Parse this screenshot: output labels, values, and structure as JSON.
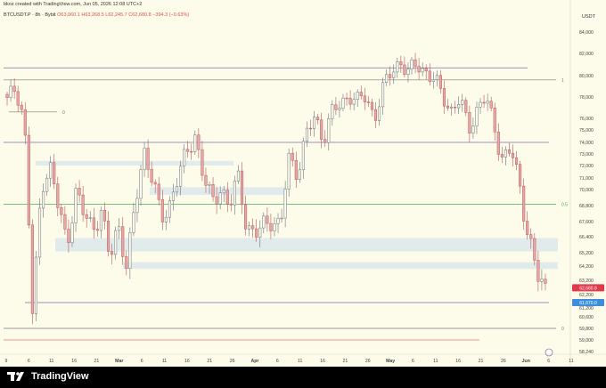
{
  "header": {
    "attribution": "bkoz created with TradingView.com, Jun 05, 2026 12:08 UTC+2"
  },
  "ohlc": {
    "symbol": "BTCUSDT.P · 8h · Bybit",
    "open": "O63,060.1",
    "high": "H63,268.5",
    "low": "L62,245.7",
    "close": "C62,680.8",
    "change": "−394.3 (−0.63%)"
  },
  "brand": {
    "name": "TradingView"
  },
  "colors": {
    "background": "#fdfbea",
    "up_candle": "#26a69a",
    "down_candle": "#ef5350",
    "candle_body": "#e8a8a8",
    "fib_line": "#7a7a7a",
    "green_line": "#4caf50",
    "purple_line": "#7b6fb0",
    "zone": "#dfe9ec",
    "last_price_badge": "#e0394a",
    "mark_price_badge": "#3b8edb"
  },
  "chart_data": {
    "type": "candlestick",
    "currency": "USDT",
    "ylim": [
      58000,
      85000
    ],
    "y_ticks": [
      "84,000",
      "82,000",
      "80,000",
      "78,000",
      "76,000",
      "75,000",
      "74,000",
      "73,000",
      "72,000",
      "71,000",
      "70,000",
      "68,800",
      "67,600",
      "66,400",
      "65,200",
      "64,200",
      "63,200",
      "62,200",
      "61,200",
      "60,600",
      "59,800",
      "59,000",
      "58,240"
    ],
    "x_ticks": [
      "9",
      "6",
      "11",
      "16",
      "21",
      "Mar",
      "6",
      "11",
      "16",
      "21",
      "26",
      "Apr",
      "6",
      "11",
      "16",
      "21",
      "26",
      "May",
      "6",
      "11",
      "16",
      "21",
      "26",
      "Jun",
      "6",
      "11"
    ],
    "last_price_label": "62,680.8",
    "mark_price_label": "61,670.0",
    "fib_levels": [
      {
        "label": "1",
        "price": 79600
      },
      {
        "label": "0.5",
        "price": 68900
      },
      {
        "label": "0",
        "price": 59800
      },
      {
        "label": "0",
        "price": 76600
      }
    ],
    "horizontal_lines": [
      {
        "price": 80700,
        "color": "purple"
      },
      {
        "price": 74000,
        "color": "purple"
      },
      {
        "price": 61600,
        "color": "purple"
      },
      {
        "price": 59000,
        "color": "red"
      }
    ],
    "zones": [
      {
        "from": 72000,
        "to": 72400
      },
      {
        "from": 69600,
        "to": 70200
      },
      {
        "from": 65300,
        "to": 66300
      },
      {
        "from": 64000,
        "to": 64500
      }
    ],
    "close_path": [
      {
        "x": "Feb 1",
        "y": 77500
      },
      {
        "x": "Feb 3",
        "y": 79000
      },
      {
        "x": "Feb 5",
        "y": 76000
      },
      {
        "x": "Feb 6",
        "y": 60100
      },
      {
        "x": "Feb 8",
        "y": 70500
      },
      {
        "x": "Feb 10",
        "y": 72000
      },
      {
        "x": "Feb 12",
        "y": 68500
      },
      {
        "x": "Feb 14",
        "y": 66000
      },
      {
        "x": "Feb 16",
        "y": 69800
      },
      {
        "x": "Feb 18",
        "y": 68000
      },
      {
        "x": "Feb 20",
        "y": 67200
      },
      {
        "x": "Feb 22",
        "y": 68400
      },
      {
        "x": "Feb 24",
        "y": 64500
      },
      {
        "x": "Feb 26",
        "y": 67600
      },
      {
        "x": "Feb 28",
        "y": 64200
      },
      {
        "x": "Mar 2",
        "y": 68600
      },
      {
        "x": "Mar 4",
        "y": 73500
      },
      {
        "x": "Mar 6",
        "y": 71000
      },
      {
        "x": "Mar 8",
        "y": 67500
      },
      {
        "x": "Mar 10",
        "y": 69000
      },
      {
        "x": "Mar 12",
        "y": 71200
      },
      {
        "x": "Mar 14",
        "y": 72800
      },
      {
        "x": "Mar 16",
        "y": 74800
      },
      {
        "x": "Mar 18",
        "y": 71000
      },
      {
        "x": "Mar 20",
        "y": 68800
      },
      {
        "x": "Mar 22",
        "y": 70400
      },
      {
        "x": "Mar 24",
        "y": 68600
      },
      {
        "x": "Mar 26",
        "y": 71000
      },
      {
        "x": "Mar 28",
        "y": 67600
      },
      {
        "x": "Mar 30",
        "y": 66400
      },
      {
        "x": "Apr 2",
        "y": 67200
      },
      {
        "x": "Apr 5",
        "y": 68000
      },
      {
        "x": "Apr 7",
        "y": 67000
      },
      {
        "x": "Apr 10",
        "y": 72600
      },
      {
        "x": "Apr 12",
        "y": 71600
      },
      {
        "x": "Apr 14",
        "y": 74500
      },
      {
        "x": "Apr 16",
        "y": 76000
      },
      {
        "x": "Apr 18",
        "y": 74500
      },
      {
        "x": "Apr 20",
        "y": 76400
      },
      {
        "x": "Apr 22",
        "y": 77200
      },
      {
        "x": "Apr 24",
        "y": 78400
      },
      {
        "x": "Apr 26",
        "y": 77500
      },
      {
        "x": "Apr 28",
        "y": 78000
      },
      {
        "x": "Apr 30",
        "y": 76200
      },
      {
        "x": "May 2",
        "y": 78600
      },
      {
        "x": "May 4",
        "y": 80500
      },
      {
        "x": "May 6",
        "y": 81400
      },
      {
        "x": "May 8",
        "y": 80000
      },
      {
        "x": "May 10",
        "y": 81200
      },
      {
        "x": "May 12",
        "y": 80400
      },
      {
        "x": "May 14",
        "y": 79400
      },
      {
        "x": "May 16",
        "y": 78200
      },
      {
        "x": "May 18",
        "y": 76800
      },
      {
        "x": "May 20",
        "y": 77600
      },
      {
        "x": "May 22",
        "y": 75200
      },
      {
        "x": "May 24",
        "y": 76900
      },
      {
        "x": "May 26",
        "y": 77800
      },
      {
        "x": "May 28",
        "y": 75400
      },
      {
        "x": "May 30",
        "y": 72600
      },
      {
        "x": "Jun 1",
        "y": 73200
      },
      {
        "x": "Jun 2",
        "y": 70400
      },
      {
        "x": "Jun 3",
        "y": 66600
      },
      {
        "x": "Jun 4",
        "y": 63400
      },
      {
        "x": "Jun 5",
        "y": 62680
      }
    ]
  }
}
